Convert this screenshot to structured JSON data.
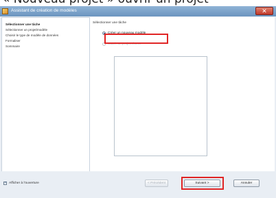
{
  "caption": "« Nouveau projet » ouvrir un projet",
  "window": {
    "title": "Assistant de création de modèles",
    "close_glyph": "✕"
  },
  "nav": {
    "items": [
      {
        "label": "Sélectionner une tâche",
        "active": true
      },
      {
        "label": "Sélectionner un projet/modèle",
        "active": false
      },
      {
        "label": "Choisir le type de modèle de données",
        "active": false
      },
      {
        "label": "Formaliser",
        "active": false
      },
      {
        "label": "Sommaire",
        "active": false
      }
    ]
  },
  "content": {
    "section_label": "Sélectionner une tâche",
    "options": [
      {
        "label": "Créer un nouveau modèle",
        "selected": true,
        "enabled": true
      },
      {
        "label": "Ouvrir un projet récent",
        "selected": false,
        "enabled": false
      }
    ]
  },
  "footer": {
    "checkbox_label": "Afficher à l'ouverture",
    "checkbox_checked": true,
    "checkbox_glyph": "✓",
    "buttons": {
      "previous": "< Précédent",
      "next": "Suivant >",
      "cancel": "Annuler"
    }
  },
  "colors": {
    "highlight": "#e02424",
    "title_bar": "#6b94bf"
  }
}
